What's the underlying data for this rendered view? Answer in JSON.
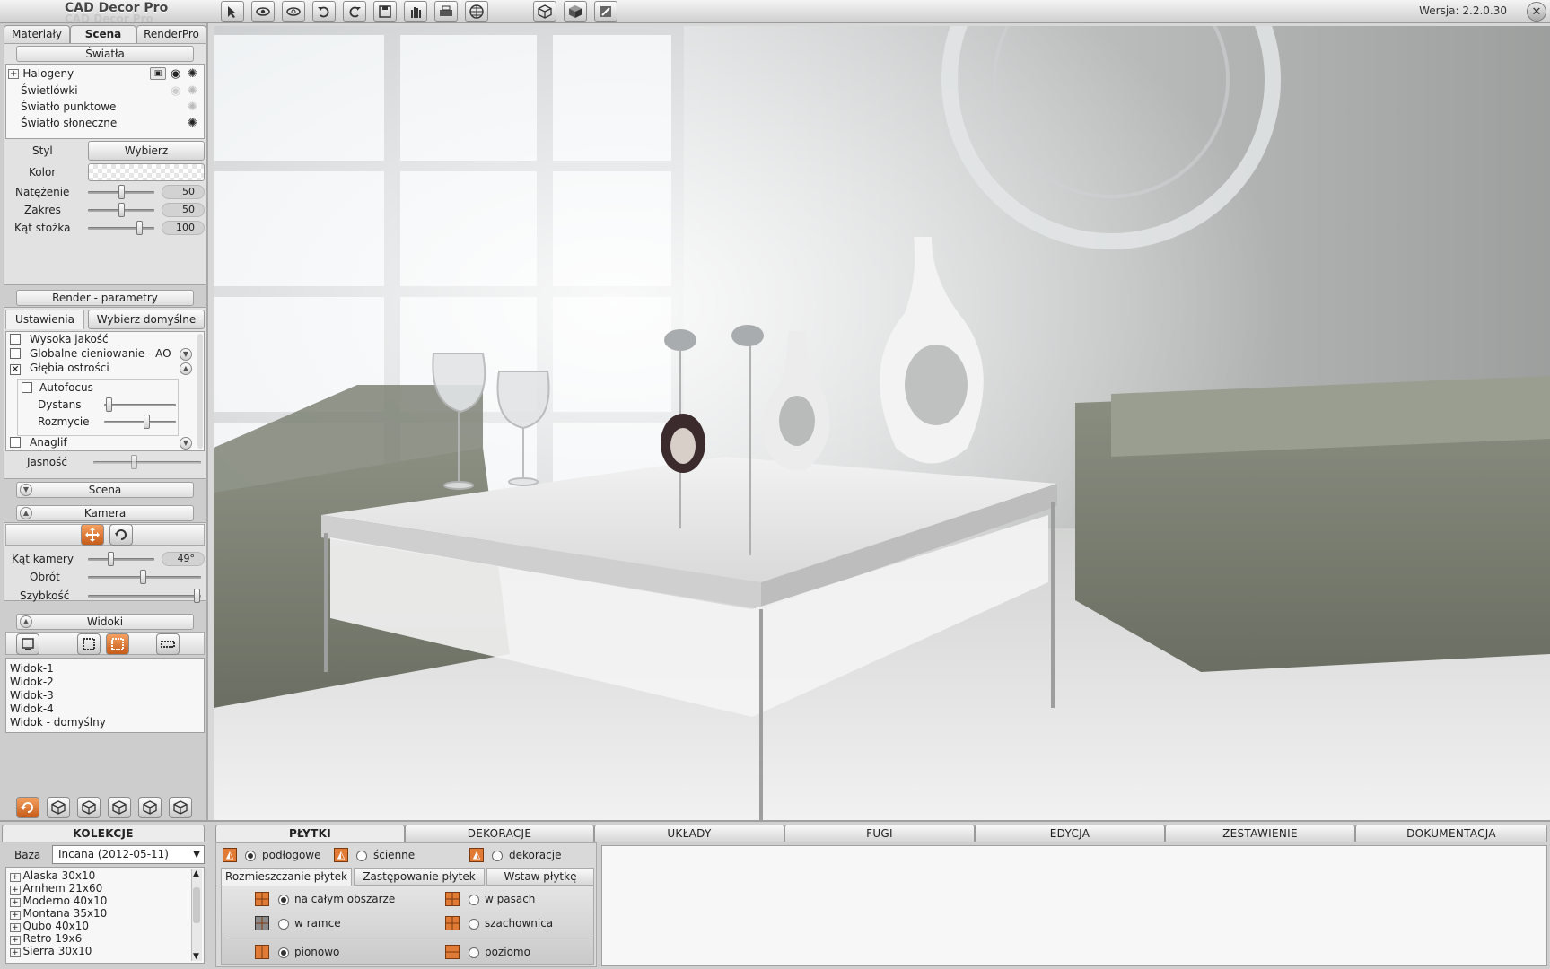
{
  "app": {
    "title": "CAD Decor Pro",
    "title_shadow": "CAD Decor Pro",
    "version": "Wersja: 2.2.0.30"
  },
  "toolbar": {
    "icons": [
      "select-arrow-icon",
      "eye-icon",
      "eye-outline-icon",
      "undo-icon",
      "redo-icon",
      "save-icon",
      "hand-icon",
      "print-icon",
      "globe-icon",
      "cube-wire-icon",
      "cube-solid-icon",
      "cube-render-icon"
    ]
  },
  "left_tabs": [
    "Materiały",
    "Scena",
    "RenderPro"
  ],
  "lights": {
    "header": "Światła",
    "items": [
      "Halogeny",
      "Świetlówki",
      "Światło punktowe",
      "Światło słoneczne"
    ],
    "style_label": "Styl",
    "style_button": "Wybierz",
    "color_label": "Kolor",
    "intensity_label": "Natężenie",
    "intensity_value": "50",
    "intensity_level": 0.5,
    "range_label": "Zakres",
    "range_value": "50",
    "range_level": 0.5,
    "cone_label": "Kąt stożka",
    "cone_value": "100",
    "cone_level": 0.82
  },
  "render": {
    "header": "Render - parametry",
    "settings_label": "Ustawienia",
    "defaults_button": "Wybierz domyślne",
    "options": [
      {
        "label": "Wysoka jakość",
        "checked": false
      },
      {
        "label": "Globalne cieniowanie - AO",
        "checked": false
      },
      {
        "label": "Głębia ostrości",
        "checked": true
      }
    ],
    "autofocus_label": "Autofocus",
    "distance_label": "Dystans",
    "blur_label": "Rozmycie",
    "anaglyph_label": "Anaglif",
    "brightness_label": "Jasność"
  },
  "scene": {
    "header": "Scena"
  },
  "camera": {
    "header": "Kamera",
    "angle_label": "Kąt kamery",
    "angle_value": "49°",
    "rotation_label": "Obrót",
    "speed_label": "Szybkość"
  },
  "views": {
    "header": "Widoki",
    "items": [
      "Widok-1",
      "Widok-2",
      "Widok-3",
      "Widok-4",
      "Widok - domyślny"
    ]
  },
  "collections": {
    "header": "KOLEKCJE",
    "base_label": "Baza",
    "base_value": "Incana (2012-05-11)",
    "items": [
      "Alaska 30x10",
      "Arnhem 21x60",
      "Moderno 40x10",
      "Montana 35x10",
      "Qubo 40x10",
      "Retro 19x6",
      "Sierra 30x10"
    ]
  },
  "bottom_tabs": [
    "PŁYTKI",
    "DEKORACJE",
    "UKŁADY",
    "FUGI",
    "EDYCJA",
    "ZESTAWIENIE",
    "DOKUMENTACJA"
  ],
  "tiles": {
    "type_options": [
      "podłogowe",
      "ścienne",
      "dekoracje"
    ],
    "subtabs": [
      "Rozmieszczanie płytek",
      "Zastępowanie płytek",
      "Wstaw płytkę"
    ],
    "placement": [
      "na całym obszarze",
      "w pasach",
      "w ramce",
      "szachownica"
    ],
    "orientation": [
      "pionowo",
      "poziomo"
    ]
  },
  "colors": {
    "accent": "#e07a35",
    "panel": "#cdcdcd"
  }
}
